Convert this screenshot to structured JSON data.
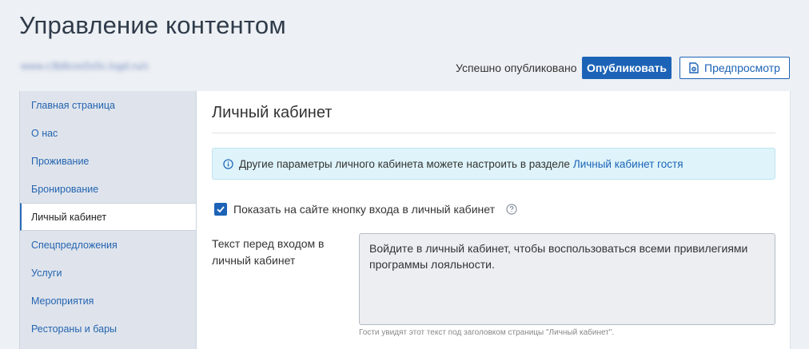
{
  "header": {
    "title": "Управление контентом",
    "site_url": "www.c3b8cos5s5c.logd.ru/c",
    "status": "Успешно опубликовано",
    "publish_label": "Опубликовать",
    "preview_label": "Предпросмотр"
  },
  "sidebar": {
    "items": [
      {
        "label": "Главная страница"
      },
      {
        "label": "О нас"
      },
      {
        "label": "Проживание"
      },
      {
        "label": "Бронирование"
      },
      {
        "label": "Личный кабинет",
        "active": true
      },
      {
        "label": "Спецпредложения"
      },
      {
        "label": "Услуги"
      },
      {
        "label": "Мероприятия"
      },
      {
        "label": "Рестораны и бары"
      }
    ]
  },
  "main": {
    "title": "Личный кабинет",
    "info": {
      "text": "Другие параметры личного кабинета можете настроить в разделе",
      "link": "Личный кабинет гостя"
    },
    "checkbox": {
      "label": "Показать на сайте кнопку входа в личный кабинет",
      "checked": true
    },
    "field": {
      "label": "Текст перед входом в личный кабинет",
      "value": "Войдите в личный кабинет, чтобы воспользоваться всеми привилегиями программы лояльности.",
      "hint": "Гости увидят этот текст под заголовком страницы \"Личный кабинет\"."
    }
  },
  "colors": {
    "accent": "#1c63b7",
    "background": "#edf0f4",
    "sidebar": "#dfe4ec",
    "info_bg": "#def4fa"
  },
  "icons": {
    "preview": "document-eye-icon",
    "info": "info-circle-icon",
    "check": "checkmark-icon",
    "help": "question-circle-icon"
  }
}
